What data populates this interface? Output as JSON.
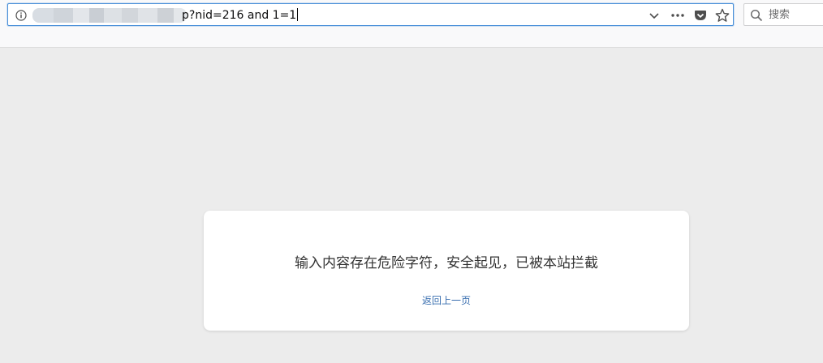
{
  "browser": {
    "url_visible_part": "p?nid=216 and 1=1",
    "search_placeholder": "搜索",
    "icons": {
      "site_info": "info-icon",
      "dropdown": "chevron-down-icon",
      "page_actions": "more-dots-icon",
      "pocket": "pocket-icon",
      "bookmark": "star-icon",
      "search": "search-icon"
    },
    "colors": {
      "urlbar_focus": "#4a90d9",
      "toolbar_bg": "#f9f9fa",
      "page_bg": "#ececec"
    }
  },
  "block_page": {
    "message": "输入内容存在危险字符，安全起见，已被本站拦截",
    "back_link": "返回上一页",
    "colors": {
      "message": "#333333",
      "link": "#3a6fb0"
    }
  }
}
